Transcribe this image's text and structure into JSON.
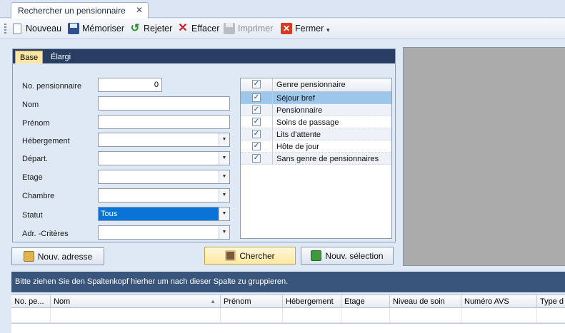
{
  "document_tab": {
    "title": "Rechercher un pensionnaire",
    "close": "✕"
  },
  "toolbar": {
    "new_label": "Nouveau",
    "save_label": "Mémoriser",
    "reject_label": "Rejeter",
    "clear_label": "Effacer",
    "print_label": "Imprimer",
    "close_label": "Fermer"
  },
  "search_panel": {
    "tabs": [
      "Base",
      "Élargi"
    ],
    "active_tab": "Base",
    "fields": {
      "resident_no": {
        "label": "No. pensionnaire",
        "value": "0"
      },
      "last_name": {
        "label": "Nom",
        "value": ""
      },
      "first_name": {
        "label": "Prénom",
        "value": ""
      },
      "accommodation": {
        "label": "Hébergement",
        "value": ""
      },
      "department": {
        "label": "Départ.",
        "value": ""
      },
      "floor": {
        "label": "Etage",
        "value": ""
      },
      "room": {
        "label": "Chambre",
        "value": ""
      },
      "status": {
        "label": "Statut",
        "value": "Tous"
      },
      "address_criteria": {
        "label": "Adr. -Critères",
        "value": ""
      }
    },
    "genre_list": {
      "header": "Genre pensionnaire",
      "items": [
        {
          "label": "Séjour bref",
          "checked": true,
          "selected": true
        },
        {
          "label": "Pensionnaire",
          "checked": true,
          "selected": false
        },
        {
          "label": "Soins de passage",
          "checked": true,
          "selected": false
        },
        {
          "label": "Lits d'attente",
          "checked": true,
          "selected": false
        },
        {
          "label": "Hôte de jour",
          "checked": true,
          "selected": false
        },
        {
          "label": "Sans genre de pensionnaires",
          "checked": true,
          "selected": false
        }
      ]
    },
    "buttons": {
      "new_address": "Nouv. adresse",
      "search": "Chercher",
      "new_selection": "Nouv. sélection"
    }
  },
  "results_grid": {
    "group_hint": "Bitte ziehen Sie den Spaltenkopf hierher um nach dieser Spalte zu gruppieren.",
    "columns": [
      "No. pe...",
      "Nom",
      "Prénom",
      "Hébergement",
      "Etage",
      "Niveau de soin",
      "Numéro AVS",
      "Type d"
    ],
    "sorted_column": "Nom"
  },
  "colors": {
    "panel_header": "#283f63",
    "active_tab": "#fde6a4",
    "selection": "#0a74d6",
    "list_selection": "#9cc6ea",
    "group_bar": "#3a557c"
  }
}
